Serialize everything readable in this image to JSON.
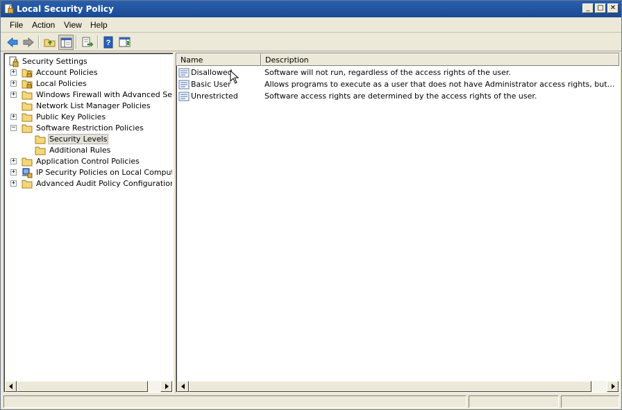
{
  "window": {
    "title": "Local Security Policy"
  },
  "title_buttons": {
    "minimize": "_",
    "maximize": "□",
    "close": "✕"
  },
  "menu": [
    "File",
    "Action",
    "View",
    "Help"
  ],
  "toolbar": {
    "buttons": [
      "back-arrow-icon",
      "forward-arrow-icon",
      "up-folder-icon",
      "show-hide-tree-icon",
      "export-list-icon",
      "help-icon",
      "action-pane-icon"
    ]
  },
  "tree": {
    "root": "Security Settings",
    "items": [
      {
        "label": "Account Policies",
        "expander": "+",
        "icon": "folder-lock-icon"
      },
      {
        "label": "Local Policies",
        "expander": "+",
        "icon": "folder-lock-icon"
      },
      {
        "label": "Windows Firewall with Advanced Security",
        "expander": "+",
        "icon": "folder-icon"
      },
      {
        "label": "Network List Manager Policies",
        "expander": "",
        "icon": "folder-icon"
      },
      {
        "label": "Public Key Policies",
        "expander": "+",
        "icon": "folder-icon"
      },
      {
        "label": "Software Restriction Policies",
        "expander": "−",
        "icon": "folder-icon"
      },
      {
        "label": "Security Levels",
        "expander": "",
        "icon": "folder-icon"
      },
      {
        "label": "Additional Rules",
        "expander": "",
        "icon": "folder-icon"
      },
      {
        "label": "Application Control Policies",
        "expander": "+",
        "icon": "folder-icon"
      },
      {
        "label": "IP Security Policies on Local Computer",
        "expander": "+",
        "icon": "ipsec-icon"
      },
      {
        "label": "Advanced Audit Policy Configuration",
        "expander": "+",
        "icon": "folder-icon"
      }
    ]
  },
  "list": {
    "columns": [
      "Name",
      "Description"
    ],
    "rows": [
      {
        "name": "Disallowed",
        "description": "Software will not run, regardless of the access rights of the user."
      },
      {
        "name": "Basic User",
        "description": "Allows programs to execute as a user that does not have Administrator access rights, but can still access resources accessible by normal users."
      },
      {
        "name": "Unrestricted",
        "description": "Software access rights are determined by the access rights of the user."
      }
    ]
  },
  "colors": {
    "titlebar": "#1b4a94",
    "chrome": "#ece9d8",
    "folder": "#f5d77a"
  }
}
